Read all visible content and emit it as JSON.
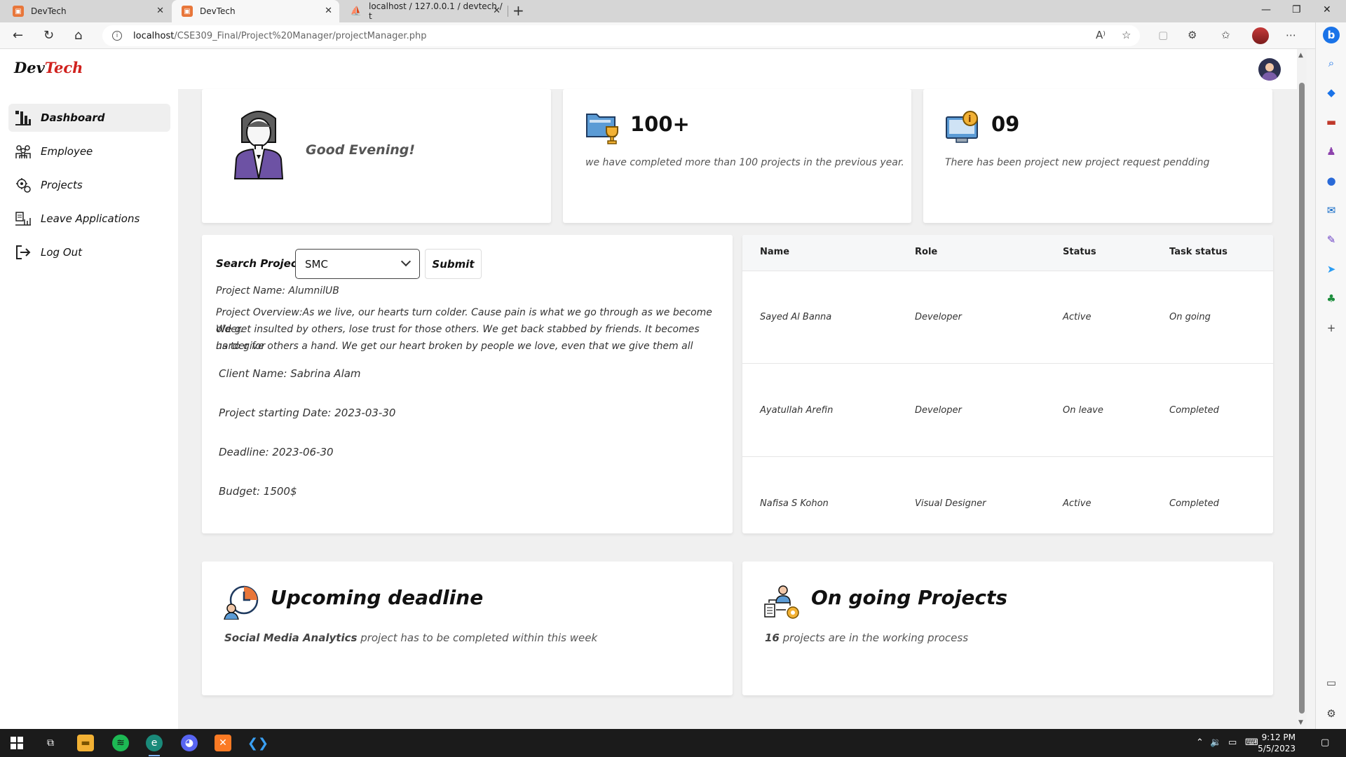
{
  "browser": {
    "tabs": [
      {
        "title": "DevTech"
      },
      {
        "title": "DevTech"
      },
      {
        "title": "localhost / 127.0.0.1 / devtech / t"
      }
    ],
    "url_host": "localhost",
    "url_path": "/CSE309_Final/Project%20Manager/projectManager.php"
  },
  "brand": {
    "part1": "Dev",
    "part2": "Tech",
    "accent_color": "#d0211d"
  },
  "sidebar": {
    "items": [
      {
        "label": "Dashboard",
        "icon": "dashboard-icon"
      },
      {
        "label": "Employee",
        "icon": "employee-icon"
      },
      {
        "label": "Projects",
        "icon": "projects-icon"
      },
      {
        "label": "Leave Applications",
        "icon": "leave-applications-icon"
      },
      {
        "label": "Log Out",
        "icon": "logout-icon"
      }
    ]
  },
  "greeting_card": {
    "text": "Good Evening!"
  },
  "stats": [
    {
      "number": "100+",
      "description": "we have completed more than 100 projects in the previous year."
    },
    {
      "number": "09",
      "description": "There has been project new project request pendding"
    }
  ],
  "search": {
    "label": "Search Project :",
    "selected": "SMC",
    "submit_label": "Submit"
  },
  "project": {
    "name": "Project Name: AlumnilUB",
    "overview_lines": [
      "Project Overview:As we live, our hearts turn colder. Cause pain is what we go through as we become older.",
      "We get insulted by others, lose trust for those others. We get back stabbed by friends. It becomes harder for",
      "us to give others a hand. We get our heart broken by people we love, even that we give them all"
    ],
    "client": "Client Name: Sabrina Alam",
    "start_date": "Project starting Date: 2023-03-30",
    "deadline": "Deadline: 2023-06-30",
    "budget": "Budget: 1500$"
  },
  "team_table": {
    "headers": [
      "Name",
      "Role",
      "Status",
      "Task status"
    ],
    "rows": [
      [
        "Sayed Al Banna",
        "Developer",
        "Active",
        "On going"
      ],
      [
        "Ayatullah Arefin",
        "Developer",
        "On leave",
        "Completed"
      ],
      [
        "Nafisa S Kohon",
        "Visual Designer",
        "Active",
        "Completed"
      ]
    ]
  },
  "upcoming": {
    "title": "Upcoming deadline",
    "highlight": "Social Media Analytics",
    "rest": " project has to be completed within this week"
  },
  "ongoing": {
    "title": "On going Projects",
    "highlight": "16",
    "rest": " projects are in the working process"
  },
  "taskbar": {
    "time": "9:12 PM",
    "date": "5/5/2023"
  }
}
